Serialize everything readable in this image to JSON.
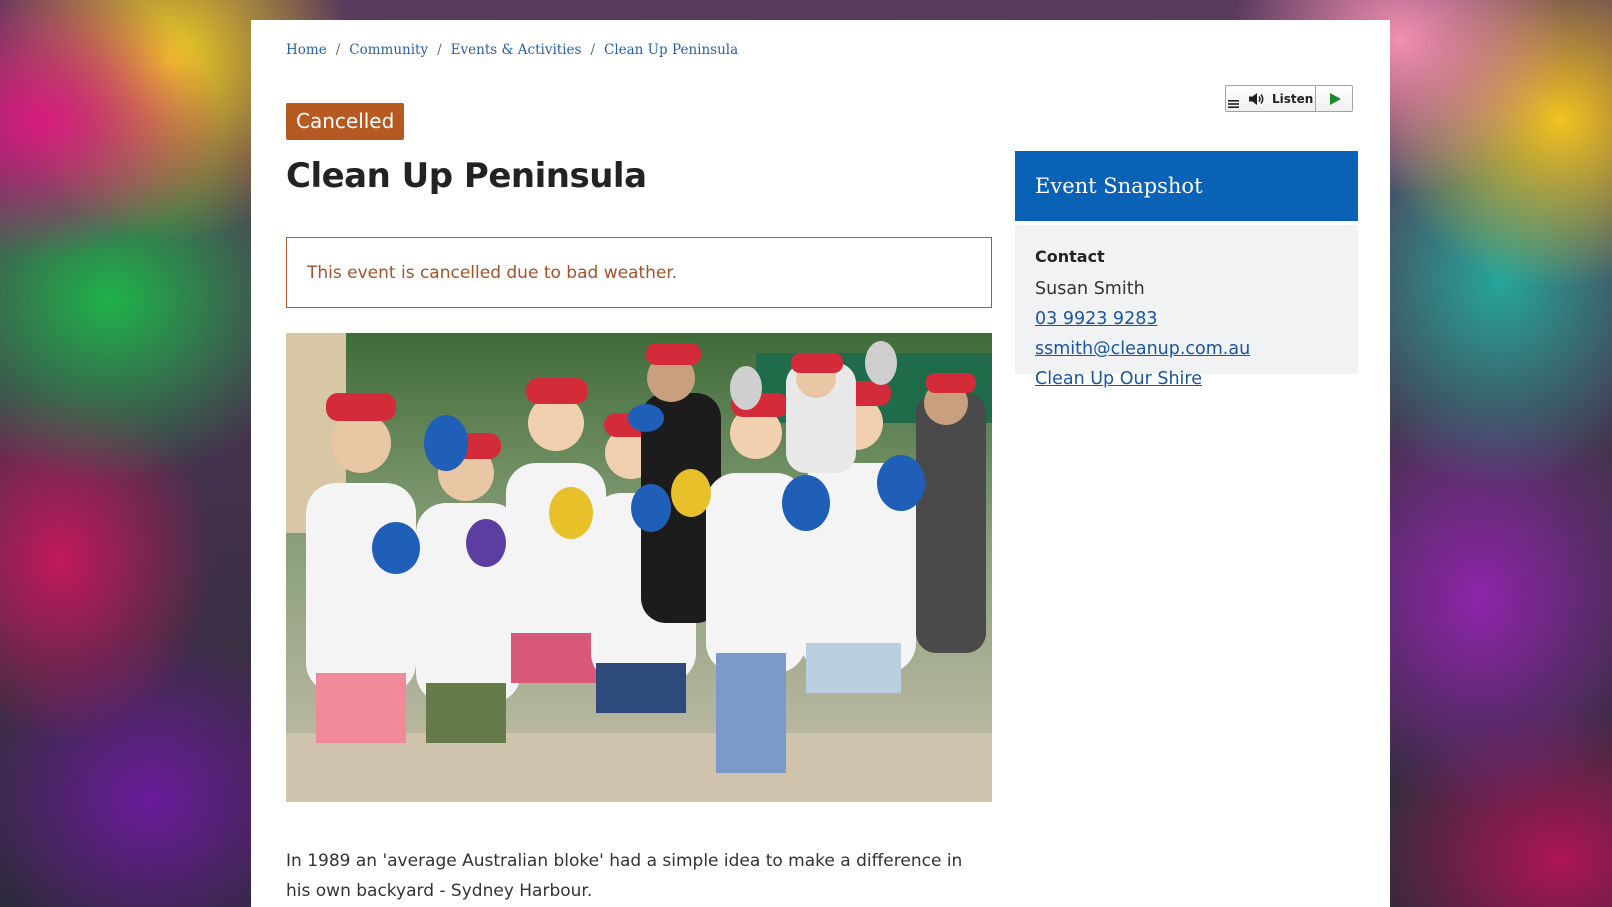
{
  "breadcrumb": {
    "items": [
      "Home",
      "Community",
      "Events & Activities",
      "Clean Up Peninsula"
    ],
    "separator": "/"
  },
  "listen": {
    "label": "Listen",
    "icons": [
      "menu-icon",
      "speaker-icon",
      "play-icon"
    ]
  },
  "status": {
    "label": "Cancelled",
    "color": "#b65a24"
  },
  "event": {
    "title": "Clean Up Peninsula",
    "notice": "This event is cancelled due to bad weather.",
    "intro": "In 1989 an 'average Australian bloke' had a simple idea to make a difference in his own backyard - Sydney Harbour."
  },
  "snapshot": {
    "heading": "Event Snapshot",
    "contact_label": "Contact",
    "name": "Susan Smith",
    "phone": "03 9923 9283",
    "email": "ssmith@cleanup.com.au",
    "website": "Clean Up Our Shire"
  },
  "colors": {
    "accent": "#0a62b6",
    "link": "#2a5fa8",
    "cancel": "#b65a24"
  }
}
